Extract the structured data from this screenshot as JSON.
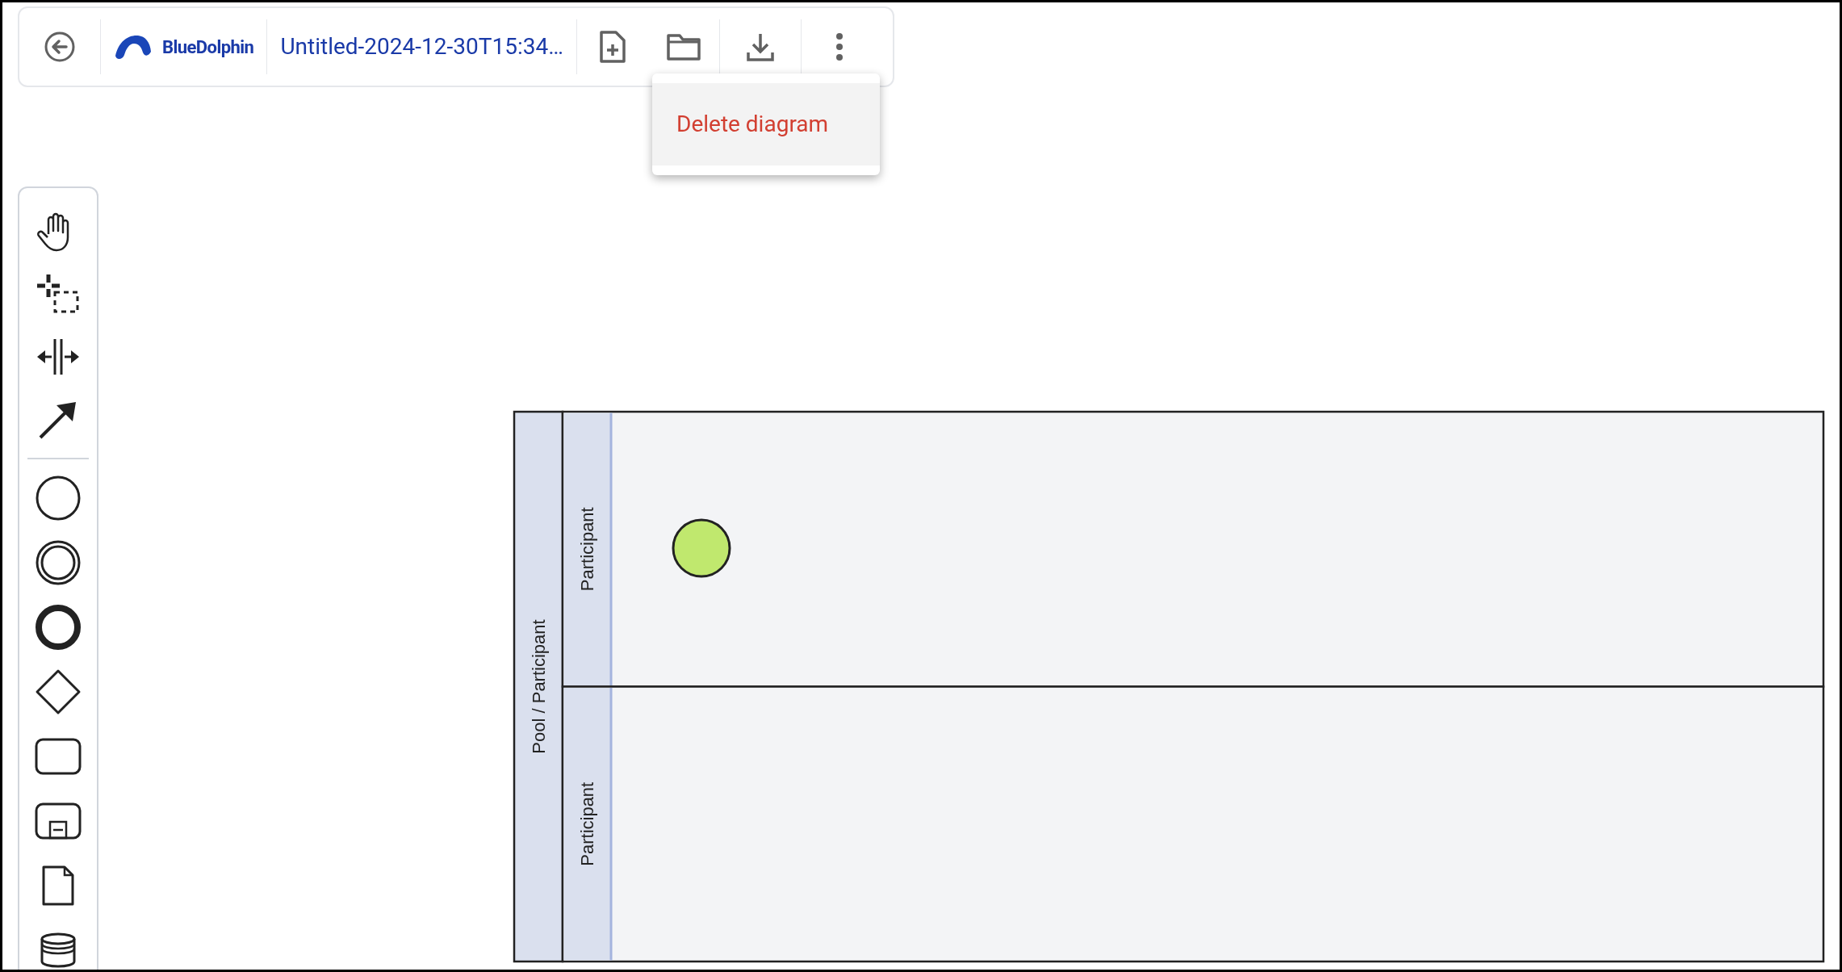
{
  "header": {
    "logo_text": "BlueDolphin",
    "title": "Untitled-2024-12-30T15:34…"
  },
  "menu": {
    "items": [
      {
        "label": "Delete diagram",
        "kind": "danger"
      }
    ]
  },
  "diagram": {
    "pool": {
      "label": "Pool / Participant"
    },
    "lanes": [
      {
        "label": "Participant",
        "events": [
          {
            "kind": "start",
            "color": "#c0e86e"
          }
        ]
      },
      {
        "label": "Participant"
      }
    ]
  }
}
